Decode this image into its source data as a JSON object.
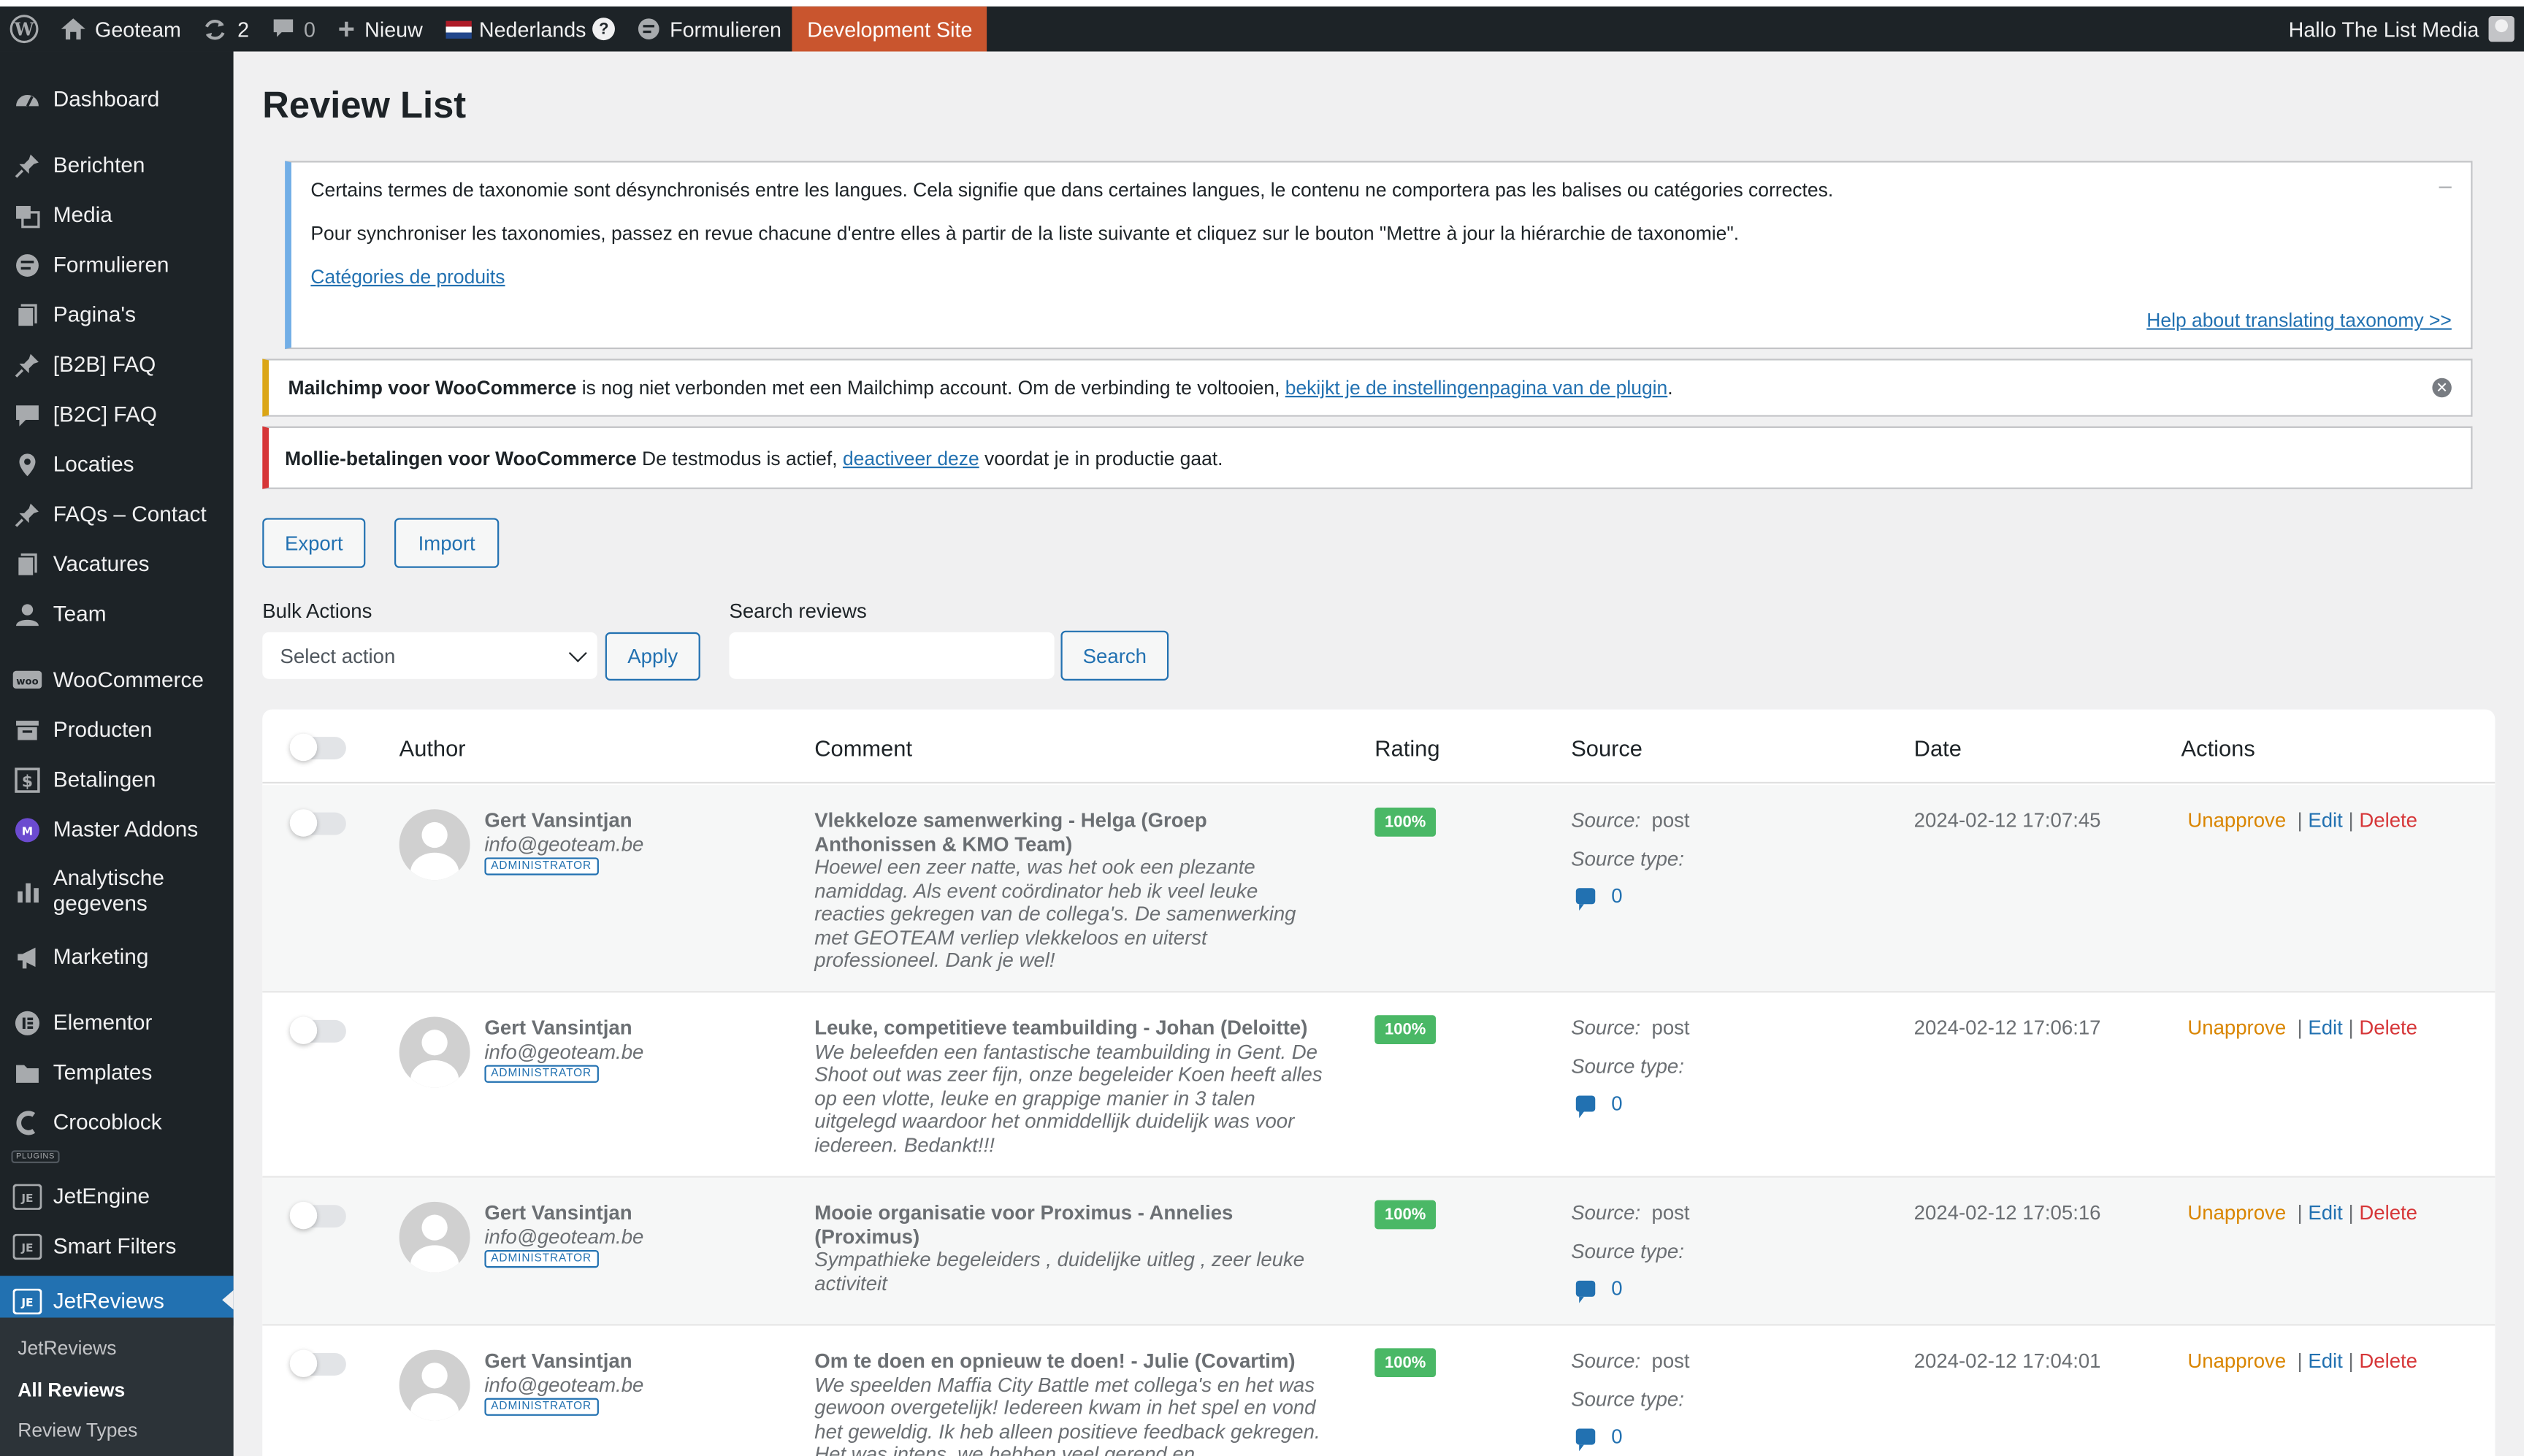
{
  "admin_bar": {
    "site_name": "Geoteam",
    "updates_count": "2",
    "comments_count": "0",
    "new_label": "Nieuw",
    "language": "Nederlands",
    "forms_label": "Formulieren",
    "dev_site_label": "Development Site",
    "greeting": "Hallo The List Media"
  },
  "sidebar": {
    "items": [
      {
        "label": "Dashboard",
        "icon": "dashboard-icon"
      },
      {
        "label": "Berichten",
        "icon": "pin-icon"
      },
      {
        "label": "Media",
        "icon": "media-icon"
      },
      {
        "label": "Formulieren",
        "icon": "forms-icon"
      },
      {
        "label": "Pagina's",
        "icon": "page-icon"
      },
      {
        "label": "[B2B] FAQ",
        "icon": "pin-icon"
      },
      {
        "label": "[B2C] FAQ",
        "icon": "comment-icon"
      },
      {
        "label": "Locaties",
        "icon": "location-icon"
      },
      {
        "label": "FAQs – Contact",
        "icon": "pin-icon"
      },
      {
        "label": "Vacatures",
        "icon": "page-icon"
      },
      {
        "label": "Team",
        "icon": "user-icon"
      },
      {
        "label": "WooCommerce",
        "icon": "woo-icon"
      },
      {
        "label": "Producten",
        "icon": "archive-icon"
      },
      {
        "label": "Betalingen",
        "icon": "dollar-icon"
      },
      {
        "label": "Master Addons",
        "icon": "master-addons-icon"
      },
      {
        "label": "Analytische gegevens",
        "icon": "chart-icon"
      },
      {
        "label": "Marketing",
        "icon": "megaphone-icon"
      },
      {
        "label": "Elementor",
        "icon": "elementor-icon"
      },
      {
        "label": "Templates",
        "icon": "folder-icon"
      },
      {
        "label": "Crocoblock",
        "icon": "crocoblock-icon"
      },
      {
        "label": "JetEngine",
        "icon": "jet-icon"
      },
      {
        "label": "Smart Filters",
        "icon": "jet-icon"
      },
      {
        "label": "JetReviews",
        "icon": "jet-icon"
      }
    ],
    "plugins_label": "PLUGINS",
    "submenu": [
      "JetReviews",
      "All Reviews",
      "Review Types"
    ]
  },
  "page": {
    "title": "Review List"
  },
  "notices": {
    "taxonomy": {
      "line1": "Certains termes de taxonomie sont désynchronisés entre les langues. Cela signifie que dans certaines langues, le contenu ne comportera pas les balises ou catégories correctes.",
      "line2": "Pour synchroniser les taxonomies, passez en revue chacune d'entre elles à partir de la liste suivante et cliquez sur le bouton \"Mettre à jour la hiérarchie de taxonomie\".",
      "link": "Catégories de produits",
      "help_link": "Help about translating taxonomy >>",
      "minimize": "–"
    },
    "mailchimp": {
      "strong": "Mailchimp voor WooCommerce",
      "text": " is nog niet verbonden met een Mailchimp account. Om de verbinding te voltooien, ",
      "link": "bekijkt je de instellingenpagina van de plugin",
      "end": "."
    },
    "mollie": {
      "strong": "Mollie-betalingen voor WooCommerce",
      "text": " De testmodus is actief, ",
      "link": "deactiveer deze",
      "end": " voordat je in productie gaat."
    }
  },
  "toolbar": {
    "export_label": "Export",
    "import_label": "Import",
    "bulk_label": "Bulk Actions",
    "bulk_placeholder": "Select action",
    "apply_label": "Apply",
    "search_label": "Search reviews",
    "search_value": "",
    "search_button": "Search"
  },
  "table": {
    "columns": [
      "Author",
      "Comment",
      "Rating",
      "Source",
      "Date",
      "Actions"
    ],
    "source_prefix": "Source:",
    "source_type_label": "Source type:",
    "actions": {
      "unapprove": "Unapprove",
      "edit": "Edit",
      "delete": "Delete",
      "sep": "|"
    },
    "rows": [
      {
        "author": "Gert Vansintjan",
        "email": "info@geoteam.be",
        "role": "ADMINISTRATOR",
        "title": "Vlekkeloze samenwerking - Helga (Groep Anthonissen & KMO Team)",
        "text": "Hoewel een zeer natte, was het ook een plezante namiddag. Als event coördinator heb ik veel leuke reacties gekregen van de collega's. De samenwerking met GEOTEAM verliep vlekkeloos en uiterst professioneel. Dank je wel!",
        "rating": "100%",
        "source": "post",
        "count": "0",
        "date": "2024-02-12 17:07:45"
      },
      {
        "author": "Gert Vansintjan",
        "email": "info@geoteam.be",
        "role": "ADMINISTRATOR",
        "title": "Leuke, competitieve teambuilding - Johan (Deloitte)",
        "text": "We beleefden een fantastische teambuilding in Gent. De Shoot out was zeer fijn, onze begeleider Koen heeft alles op een vlotte, leuke en grappige manier in 3 talen uitgelegd waardoor het onmiddellijk duidelijk was voor iedereen. Bedankt!!!",
        "rating": "100%",
        "source": "post",
        "count": "0",
        "date": "2024-02-12 17:06:17"
      },
      {
        "author": "Gert Vansintjan",
        "email": "info@geoteam.be",
        "role": "ADMINISTRATOR",
        "title": "Mooie organisatie voor Proximus - Annelies (Proximus)",
        "text": "Sympathieke begeleiders , duidelijke uitleg , zeer leuke activiteit",
        "rating": "100%",
        "source": "post",
        "count": "0",
        "date": "2024-02-12 17:05:16"
      },
      {
        "author": "Gert Vansintjan",
        "email": "info@geoteam.be",
        "role": "ADMINISTRATOR",
        "title": "Om te doen en opnieuw te doen! - Julie (Covartim)",
        "text": "We speelden Maffia City Battle met collega's en het was gewoon overgetelijk! Iedereen kwam in het spel en vond het geweldig. Ik heb alleen positieve feedback gekregen. Het was intens, we hebben veel gerend en",
        "rating": "100%",
        "source": "post",
        "count": "0",
        "date": "2024-02-12 17:04:01"
      }
    ]
  },
  "colors": {
    "admin_bar_bg": "#1d2327",
    "accent": "#2271b1",
    "dev_site": "#c9552e",
    "rating_badge": "#4ab866",
    "unapprove": "#d98500",
    "delete": "#d63638"
  }
}
